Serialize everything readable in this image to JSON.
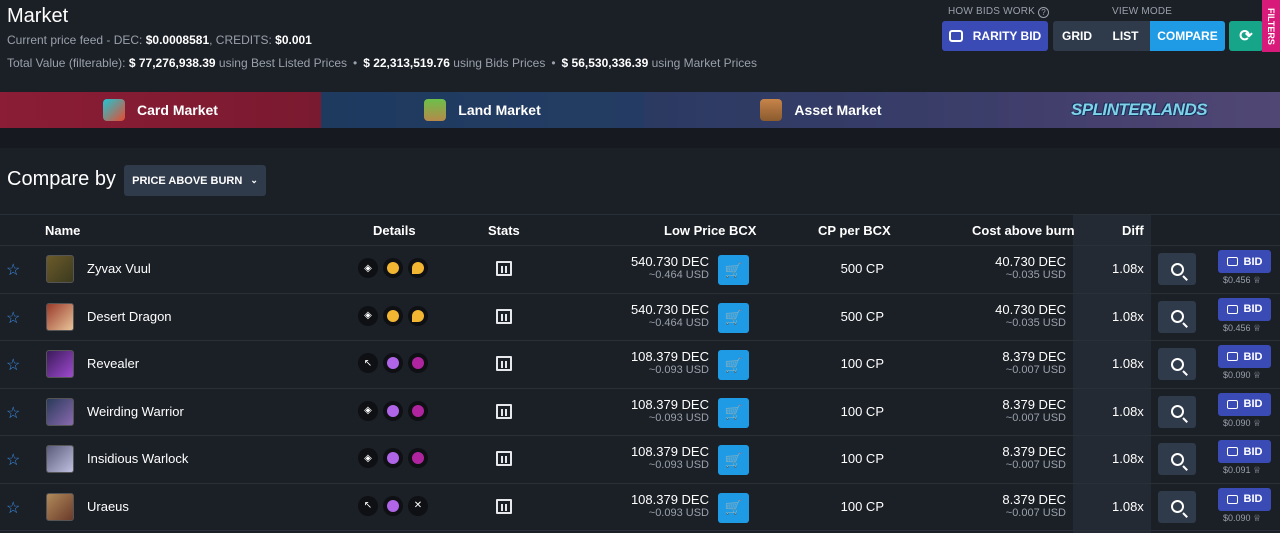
{
  "header": {
    "title": "Market",
    "feed_label": "Current price feed - DEC: ",
    "dec_price": "$0.0008581",
    "credits_label": ", CREDITS: ",
    "credits_price": "$0.001",
    "total_label": "Total Value (filterable): ",
    "total_best_value": "$ 77,276,938.39",
    "total_best_label": " using Best Listed Prices",
    "total_bids_value": "$ 22,313,519.76",
    "total_bids_label": " using Bids Prices",
    "total_market_value": "$ 56,530,336.39",
    "total_market_label": " using Market Prices",
    "how_bids_work": "HOW BIDS WORK",
    "view_mode_label": "VIEW MODE",
    "rarity_bid": "RARITY BID",
    "grid": "GRID",
    "list": "LIST",
    "compare": "COMPARE",
    "filters": "FILTERS"
  },
  "tabs": [
    {
      "label": "Card Market"
    },
    {
      "label": "Land Market"
    },
    {
      "label": "Asset Market"
    },
    {
      "label": "SPLINTERLANDS"
    }
  ],
  "compare": {
    "label": "Compare by",
    "selected": "PRICE ABOVE BURN"
  },
  "columns": {
    "name": "Name",
    "details": "Details",
    "stats": "Stats",
    "low_price": "Low Price BCX",
    "cp_per_bcx": "CP per BCX",
    "cost_above_burn": "Cost above burn",
    "diff": "Diff"
  },
  "rows": [
    {
      "name": "Zyvax Vuul",
      "price": "540.730 DEC",
      "price_usd": "~0.464 USD",
      "cp": "500 CP",
      "burn": "40.730 DEC",
      "burn_usd": "~0.035 USD",
      "diff": "1.08x",
      "bid": "BID",
      "bid_price": "$0.456"
    },
    {
      "name": "Desert Dragon",
      "price": "540.730 DEC",
      "price_usd": "~0.464 USD",
      "cp": "500 CP",
      "burn": "40.730 DEC",
      "burn_usd": "~0.035 USD",
      "diff": "1.08x",
      "bid": "BID",
      "bid_price": "$0.456"
    },
    {
      "name": "Revealer",
      "price": "108.379 DEC",
      "price_usd": "~0.093 USD",
      "cp": "100 CP",
      "burn": "8.379 DEC",
      "burn_usd": "~0.007 USD",
      "diff": "1.08x",
      "bid": "BID",
      "bid_price": "$0.090"
    },
    {
      "name": "Weirding Warrior",
      "price": "108.379 DEC",
      "price_usd": "~0.093 USD",
      "cp": "100 CP",
      "burn": "8.379 DEC",
      "burn_usd": "~0.007 USD",
      "diff": "1.08x",
      "bid": "BID",
      "bid_price": "$0.090"
    },
    {
      "name": "Insidious Warlock",
      "price": "108.379 DEC",
      "price_usd": "~0.093 USD",
      "cp": "100 CP",
      "burn": "8.379 DEC",
      "burn_usd": "~0.007 USD",
      "diff": "1.08x",
      "bid": "BID",
      "bid_price": "$0.091"
    },
    {
      "name": "Uraeus",
      "price": "108.379 DEC",
      "price_usd": "~0.093 USD",
      "cp": "100 CP",
      "burn": "8.379 DEC",
      "burn_usd": "~0.007 USD",
      "diff": "1.08x",
      "bid": "BID",
      "bid_price": "$0.090"
    }
  ],
  "colors": {
    "accent_blue": "#1f9be6",
    "bid_indigo": "#3a4bb6",
    "filters_pink": "#d81b7a",
    "refresh_teal": "#17a589"
  }
}
